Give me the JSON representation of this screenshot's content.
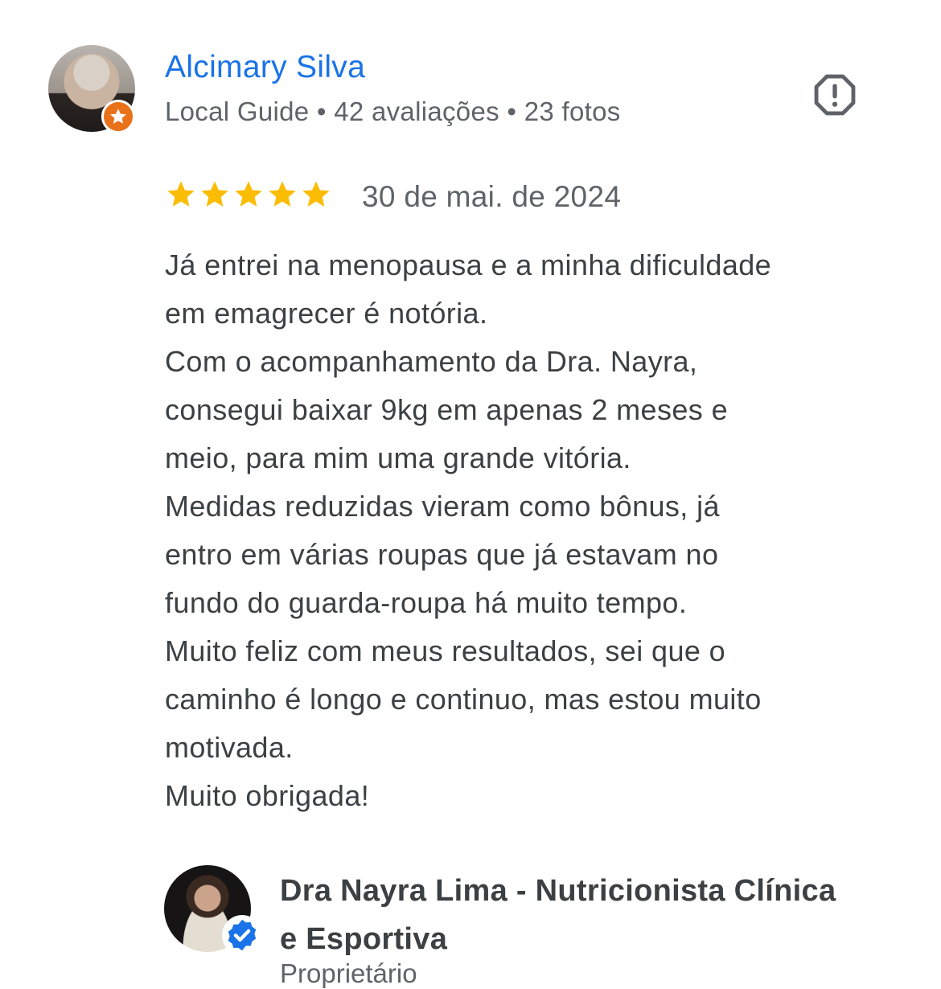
{
  "review": {
    "author": {
      "name": "Alcimary Silva",
      "meta": "Local Guide • 42 avaliações • 23 fotos",
      "avatar_icon": "user-photo",
      "badge_icon": "local-guide-star-icon",
      "badge_color": "#e8711a"
    },
    "report_icon": "report-octagon-icon",
    "rating": 5,
    "rating_max": 5,
    "star_color": "#fbbc04",
    "date": "30 de mai. de 2024",
    "text_lines": [
      "Já entrei na menopausa e a minha dificuldade",
      "em emagrecer é notória.",
      "Com o acompanhamento da Dra. Nayra,",
      "consegui baixar 9kg em apenas 2 meses e",
      "meio, para mim uma grande vitória.",
      "Medidas reduzidas vieram como bônus, já",
      "entro em várias roupas que já estavam no",
      "fundo do guarda-roupa há muito tempo.",
      "Muito feliz com meus resultados, sei que o",
      "caminho é longo e continuo, mas estou muito",
      "motivada.",
      "Muito obrigada!"
    ]
  },
  "owner": {
    "name_lines": [
      "Dra Nayra Lima - Nutricionista Clínica",
      "e Esportiva"
    ],
    "role": "Proprietário",
    "verified_icon": "verified-check-icon",
    "verified_color": "#1a73e8"
  },
  "colors": {
    "link": "#1a73e8",
    "text": "#3c4043",
    "secondary": "#5f6368"
  }
}
